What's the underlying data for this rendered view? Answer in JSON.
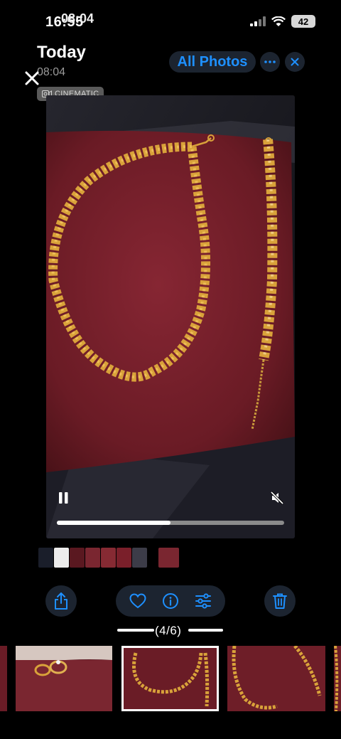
{
  "status_bar": {
    "time": "16:55",
    "time_overlay": "08:04",
    "battery": "42"
  },
  "header": {
    "title": "Today",
    "subtitle": "08:04",
    "badge": "CINEMATIC",
    "all_photos_label": "All Photos"
  },
  "video": {
    "playback_progress": 0.5,
    "state": "playing",
    "muted": true
  },
  "pager": {
    "label": "(4/6)"
  },
  "colors": {
    "accent": "#1e90ff",
    "button_bg": "#1c2430",
    "fabric": "#7a1f2a",
    "gold": "#d9a23a"
  },
  "icons": [
    "close-icon",
    "ellipsis-icon",
    "cinematic-camera-icon",
    "pause-icon",
    "speaker-muted-icon",
    "share-icon",
    "heart-icon",
    "info-icon",
    "adjust-icon",
    "trash-icon"
  ]
}
